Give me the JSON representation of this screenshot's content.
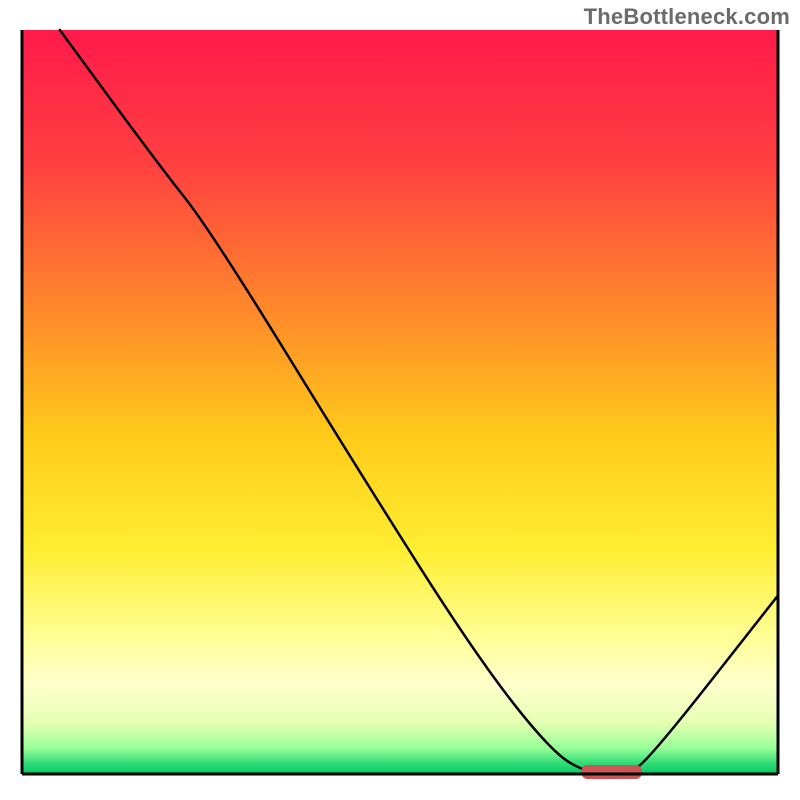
{
  "watermark": "TheBottleneck.com",
  "chart_data": {
    "type": "line",
    "title": "",
    "xlabel": "",
    "ylabel": "",
    "xlim": [
      0,
      100
    ],
    "ylim": [
      0,
      100
    ],
    "background_gradient_stops": [
      {
        "offset": 0,
        "color": "#ff1a4b"
      },
      {
        "offset": 0.18,
        "color": "#ff4040"
      },
      {
        "offset": 0.38,
        "color": "#ff8a2a"
      },
      {
        "offset": 0.55,
        "color": "#ffcc1a"
      },
      {
        "offset": 0.7,
        "color": "#ffee33"
      },
      {
        "offset": 0.82,
        "color": "#ffff99"
      },
      {
        "offset": 0.88,
        "color": "#ffffcc"
      },
      {
        "offset": 0.93,
        "color": "#e6ffb3"
      },
      {
        "offset": 0.965,
        "color": "#99ff99"
      },
      {
        "offset": 0.985,
        "color": "#33dd77"
      },
      {
        "offset": 1.0,
        "color": "#00cc66"
      }
    ],
    "series": [
      {
        "name": "bottleneck-curve",
        "x": [
          5,
          18,
          25,
          45,
          60,
          70,
          75,
          80,
          83,
          100
        ],
        "y": [
          100,
          82,
          73,
          40,
          16,
          3,
          0,
          0,
          2,
          24
        ]
      }
    ],
    "marker": {
      "name": "recommended-range",
      "shape": "rounded-bar",
      "x_start": 74,
      "x_end": 82,
      "y": 0,
      "color": "#cc5555"
    },
    "axes": {
      "left": {
        "visible": true,
        "color": "#000000",
        "width": 2
      },
      "bottom": {
        "visible": true,
        "color": "#000000",
        "width": 2
      },
      "right": {
        "visible": true,
        "color": "#000000",
        "width": 2
      },
      "top": {
        "visible": false
      }
    }
  }
}
